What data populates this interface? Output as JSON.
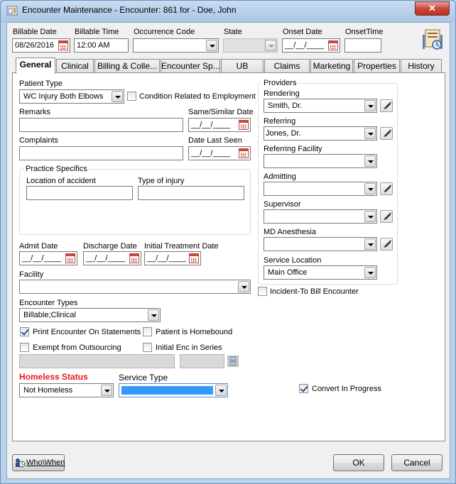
{
  "window": {
    "title": "Encounter Maintenance - Encounter: 861 for - Doe, John",
    "close_glyph": "✕"
  },
  "header": {
    "billable_date_label": "Billable Date",
    "billable_date_value": "08/26/2016",
    "billable_time_label": "Billable Time",
    "billable_time_value": "12:00 AM",
    "occurrence_code_label": "Occurrence Code",
    "occurrence_code_value": "",
    "state_label": "State",
    "state_value": "",
    "onset_date_label": "Onset Date",
    "onset_date_value": "__/__/____",
    "onset_time_label": "OnsetTime",
    "onset_time_value": ""
  },
  "tabs": [
    {
      "label": "General",
      "active": true
    },
    {
      "label": "Clinical",
      "active": false
    },
    {
      "label": "Billing & Colle...",
      "active": false
    },
    {
      "label": "Encounter  Sp...",
      "active": false
    },
    {
      "label": "UB",
      "active": false
    },
    {
      "label": "Claims",
      "active": false
    },
    {
      "label": "Marketing",
      "active": false
    },
    {
      "label": "Properties",
      "active": false
    },
    {
      "label": "History",
      "active": false
    }
  ],
  "general": {
    "patient_type_label": "Patient Type",
    "patient_type_value": "WC Injury Both Elbows",
    "condition_related_label": "Condition Related to Employment",
    "remarks_label": "Remarks",
    "remarks_value": "",
    "same_similar_date_label": "Same/Similar Date",
    "same_similar_date_value": "__/__/____",
    "complaints_label": "Complaints",
    "complaints_value": "",
    "date_last_seen_label": "Date Last Seen",
    "date_last_seen_value": "__/__/____",
    "practice_specifics_label": "Practice Specifics",
    "location_of_accident_label": "Location of accident",
    "location_of_accident_value": "",
    "type_of_injury_label": "Type of injury",
    "type_of_injury_value": "",
    "admit_date_label": "Admit Date",
    "admit_date_value": "__/__/____",
    "discharge_date_label": "Discharge Date",
    "discharge_date_value": "__/__/____",
    "initial_treatment_date_label": "Initial Treatment Date",
    "initial_treatment_date_value": "__/__/____",
    "facility_label": "Facility",
    "facility_value": "",
    "encounter_types_label": "Encounter Types",
    "encounter_types_value": "Billable;Clinical",
    "print_encounter_label": "Print Encounter On Statements",
    "print_encounter_checked": true,
    "patient_homebound_label": "Patient is Homebound",
    "patient_homebound_checked": false,
    "exempt_outsourcing_label": "Exempt from Outsourcing",
    "exempt_outsourcing_checked": false,
    "initial_enc_label": "Initial Enc in Series",
    "initial_enc_checked": false,
    "homeless_status_label": "Homeless Status",
    "homeless_status_value": "Not Homeless",
    "service_type_label": "Service Type",
    "service_type_value": "",
    "incident_to_label": "Incident-To Bill Encounter",
    "incident_to_checked": false,
    "convert_in_progress_label": "Convert In Progress",
    "convert_in_progress_checked": true
  },
  "providers": {
    "title": "Providers",
    "rendering_label": "Rendering",
    "rendering_value": "Smith, Dr.",
    "referring_label": "Referring",
    "referring_value": "Jones, Dr.",
    "referring_facility_label": "Referring Facility",
    "referring_facility_value": "",
    "admitting_label": "Admitting",
    "admitting_value": "",
    "supervisor_label": "Supervisor",
    "supervisor_value": "",
    "md_anesthesia_label": "MD Anesthesia",
    "md_anesthesia_value": "",
    "service_location_label": "Service Location",
    "service_location_value": "Main Office"
  },
  "footer": {
    "who_when_label": "Who\\When",
    "ok_label": "OK",
    "cancel_label": "Cancel"
  },
  "colors": {
    "window_frame": "#b9d1ea",
    "close_button": "#c9483a",
    "homeless_label": "#e8161e",
    "selection": "#3399ff"
  }
}
